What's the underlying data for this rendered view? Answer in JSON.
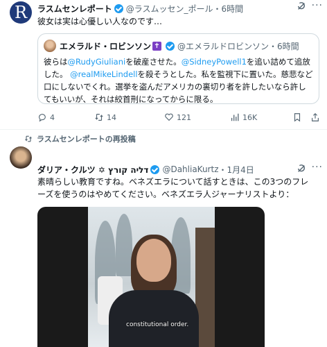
{
  "tweet1": {
    "avatar_letter": "R",
    "name": "ラスムセンレポート",
    "handle": "@ラスムッセン_ポール",
    "time": "・6時間",
    "text": "彼女は実は心優しい人なのです…",
    "quote": {
      "name": "エメラルド・ロビンソン",
      "badge": "✝",
      "handle": "@エメラルドロビンソン",
      "time": "・6時間",
      "text_parts": {
        "p1": "彼らは",
        "l1": "@RudyGiuliani",
        "p2": "を破産させた。",
        "l2": "@SidneyPowell1",
        "p3": "を追い詰めて追放した。 ",
        "l3": "@realMikeLindell",
        "p4": "を殺そうとした。私を監視下に置いた。慈悲など口にしないでくれ。選挙を盗んだアメリカの裏切り者を許したいなら許してもいいが、それは絞首刑になってからに限る。"
      }
    },
    "actions": {
      "replies": "4",
      "retweets": "14",
      "likes": "121",
      "views": "16K"
    }
  },
  "tweet2": {
    "retweet_label": "ラスムセンレポートの再投稿",
    "name": "ダリア・クルツ ✡ דליה קורץ",
    "handle": "@DahliaKurtz",
    "time": "・1月4日",
    "text": "素晴らしい教育ですね。ベネズエラについて話すときは、この3つのフレーズを使うのはやめてください。ベネズエラ人ジャーナリストより：",
    "video_caption": "constitutional order."
  },
  "colors": {
    "accent": "#1d9bf0",
    "avatar_bg": "#1f3a7a",
    "text_gray": "#536471"
  }
}
